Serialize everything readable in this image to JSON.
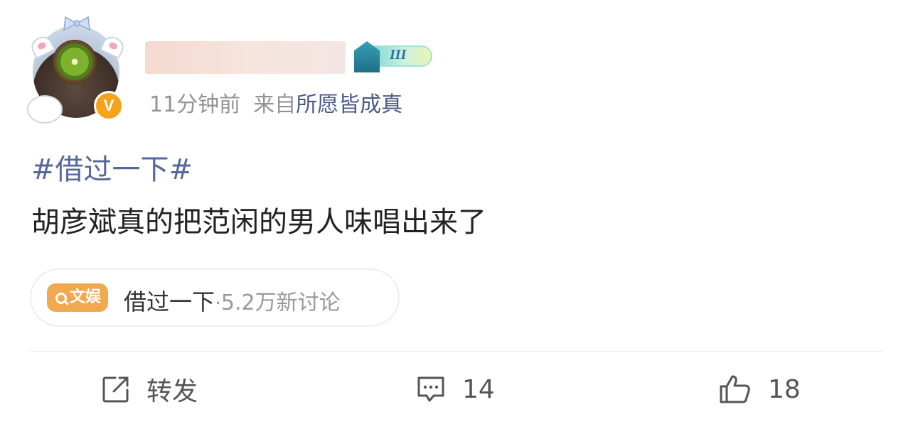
{
  "author": {
    "name": "",
    "verified_icon": "v-badge",
    "member_level": "III"
  },
  "meta": {
    "time": "11分钟前",
    "source_prefix": "来自",
    "source": "所愿皆成真"
  },
  "content": {
    "topic": "#借过一下#",
    "text": "胡彦斌真的把范闲的男人味唱出来了"
  },
  "topic_card": {
    "tag_label": "文娱",
    "tag_icon": "search-icon",
    "name": "借过一下",
    "separator": "·",
    "count": "5.2万新讨论"
  },
  "actions": {
    "repost": {
      "icon": "repost-icon",
      "label": "转发"
    },
    "comment": {
      "icon": "comment-icon",
      "label": "14"
    },
    "like": {
      "icon": "thumbs-up-icon",
      "label": "18"
    }
  },
  "colors": {
    "link": "#55689c",
    "tag": "#f2a84e",
    "verified": "#f7a21b",
    "meta": "#939393"
  }
}
